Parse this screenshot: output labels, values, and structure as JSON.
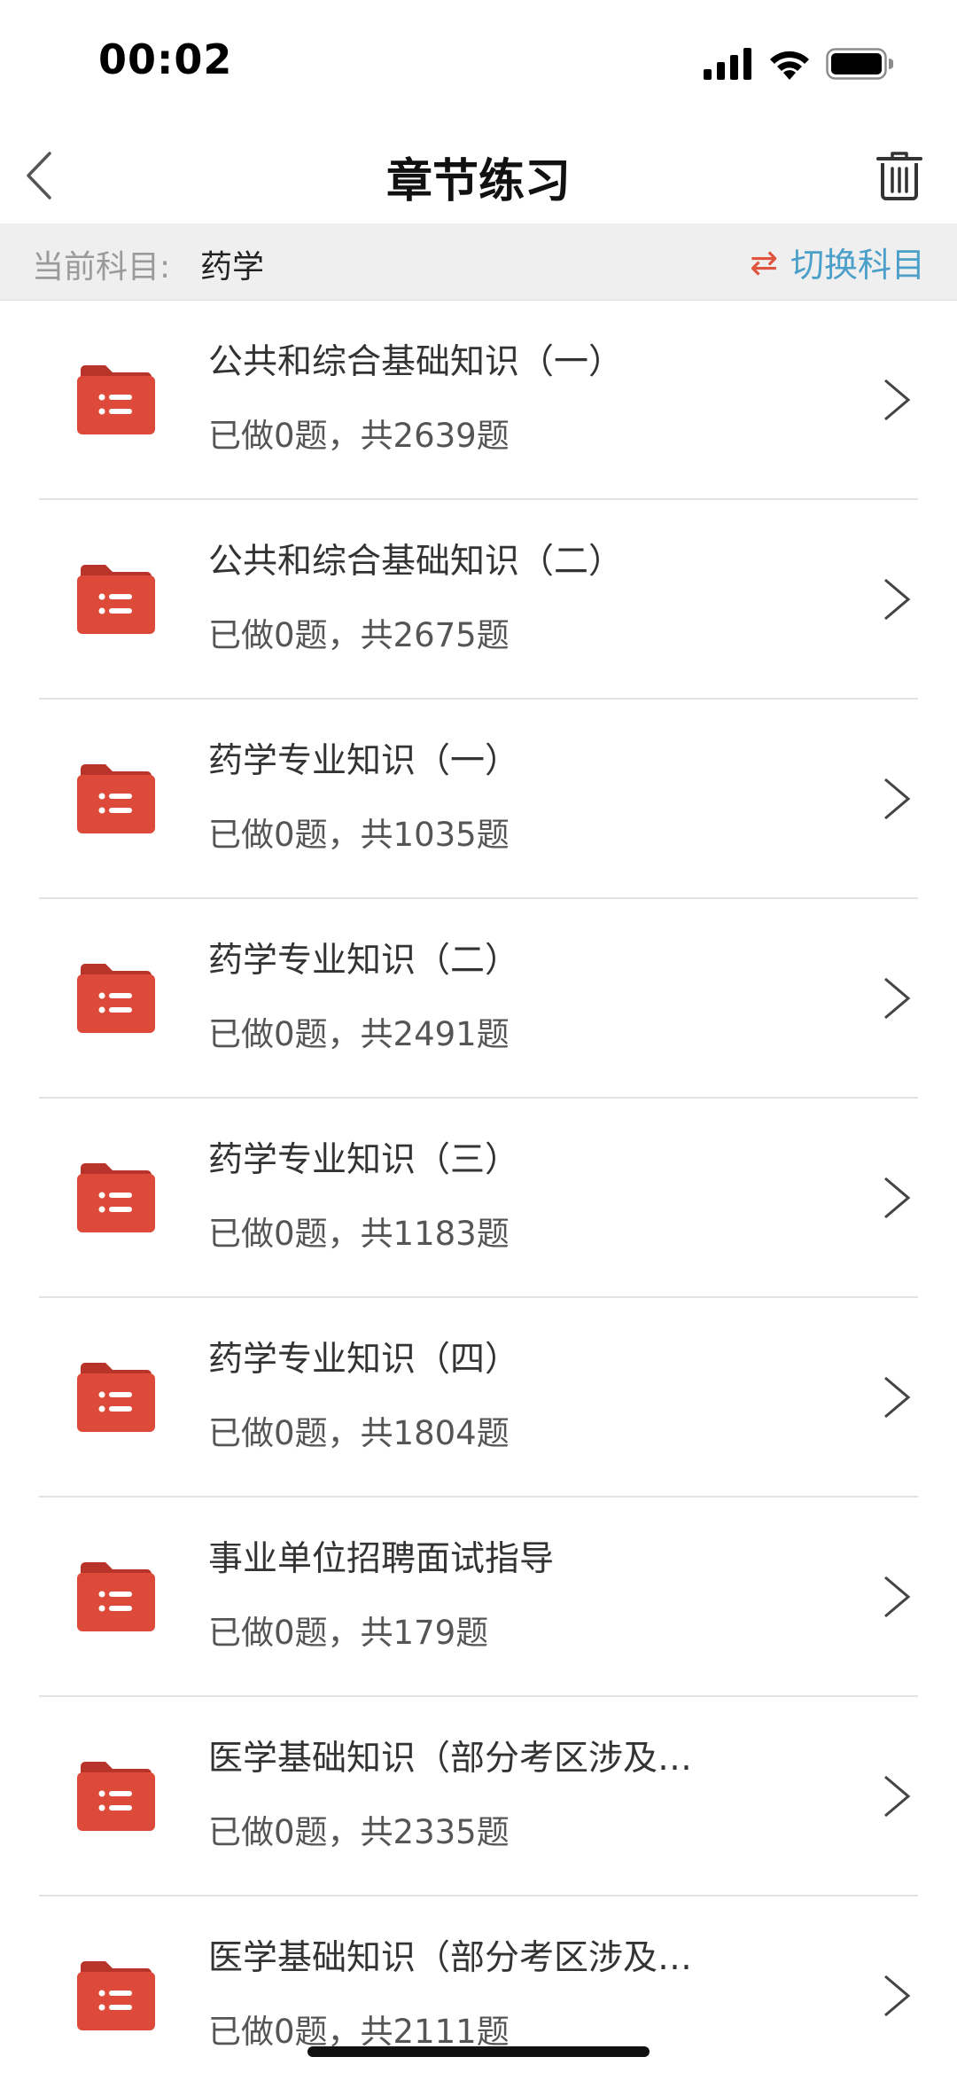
{
  "status_bar": {
    "time": "00:02"
  },
  "header": {
    "title": "章节练习"
  },
  "subject": {
    "label": "当前科目:",
    "value": "药学",
    "switch_label": "切换科目"
  },
  "colors": {
    "accent_red": "#d9493a",
    "accent_blue": "#4c9fc8"
  },
  "items": [
    {
      "title": "公共和综合基础知识（一）",
      "subtitle": "已做0题，共2639题"
    },
    {
      "title": "公共和综合基础知识（二）",
      "subtitle": "已做0题，共2675题"
    },
    {
      "title": "药学专业知识（一）",
      "subtitle": "已做0题，共1035题"
    },
    {
      "title": "药学专业知识（二）",
      "subtitle": "已做0题，共2491题"
    },
    {
      "title": "药学专业知识（三）",
      "subtitle": "已做0题，共1183题"
    },
    {
      "title": "药学专业知识（四）",
      "subtitle": "已做0题，共1804题"
    },
    {
      "title": "事业单位招聘面试指导",
      "subtitle": "已做0题，共179题"
    },
    {
      "title": "医学基础知识（部分考区涉及…",
      "subtitle": "已做0题，共2335题"
    },
    {
      "title": "医学基础知识（部分考区涉及…",
      "subtitle": "已做0题，共2111题"
    }
  ]
}
